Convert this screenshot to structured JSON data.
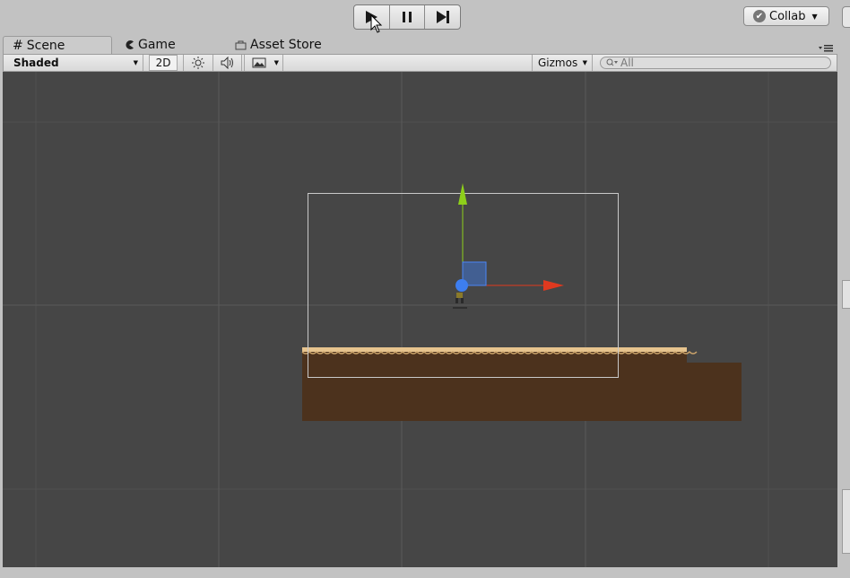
{
  "toolbar": {
    "play": {
      "icon": "play-icon"
    },
    "pause": {
      "icon": "pause-icon"
    },
    "step": {
      "icon": "step-icon"
    },
    "collab": {
      "label": "Collab",
      "icon": "check-circle-icon"
    }
  },
  "tabs": [
    {
      "label": "Scene",
      "icon": "grid-icon",
      "active": true
    },
    {
      "label": "Game",
      "icon": "pacman-icon",
      "active": false
    },
    {
      "label": "Asset Store",
      "icon": "bag-icon",
      "active": false
    }
  ],
  "scene_toolbar": {
    "draw_mode": "Shaded",
    "mode_2d": "2D",
    "lighting_icon": "sun-icon",
    "audio_icon": "speaker-icon",
    "effects_icon": "image-icon",
    "gizmos": "Gizmos",
    "search_placeholder": "All"
  },
  "scene": {
    "background_color": "#464646",
    "ground_color": "#4c321d",
    "grass_color": "#e7c48e",
    "axis_colors": {
      "x": "#e0391f",
      "y": "#8ed01a",
      "center": "#3d7ef0"
    },
    "camera_frame_color": "#c9c9c9"
  }
}
